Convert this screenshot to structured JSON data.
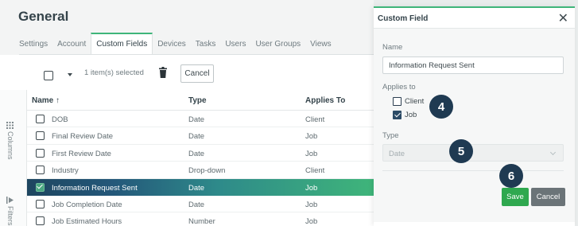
{
  "page": {
    "title": "General"
  },
  "tabs": [
    "Settings",
    "Account",
    "Custom Fields",
    "Devices",
    "Tasks",
    "Users",
    "User Groups",
    "Views"
  ],
  "active_tab": "Custom Fields",
  "toolbar": {
    "selected_text": "1 item(s) selected",
    "cancel_label": "Cancel",
    "trash_icon": "trash-icon"
  },
  "rail": {
    "columns_label": "Columns",
    "filters_label": "Filters"
  },
  "table": {
    "columns": {
      "name": "Name ↑",
      "type": "Type",
      "applies_to": "Applies To"
    },
    "rows": [
      {
        "name": "DOB",
        "type": "Date",
        "applies_to": "Client",
        "selected": false
      },
      {
        "name": "Final Review Date",
        "type": "Date",
        "applies_to": "Job",
        "selected": false
      },
      {
        "name": "First Review Date",
        "type": "Date",
        "applies_to": "Job",
        "selected": false
      },
      {
        "name": "Industry",
        "type": "Drop-down",
        "applies_to": "Client",
        "selected": false
      },
      {
        "name": "Information Request Sent",
        "type": "Date",
        "applies_to": "Job",
        "selected": true
      },
      {
        "name": "Job Completion Date",
        "type": "Date",
        "applies_to": "Job",
        "selected": false
      },
      {
        "name": "Job Estimated Hours",
        "type": "Number",
        "applies_to": "Job",
        "selected": false
      }
    ]
  },
  "panel": {
    "title": "Custom Field",
    "close_glyph": "✕",
    "name_label": "Name",
    "name_value": "Information Request Sent",
    "applies_label": "Applies to",
    "options": [
      {
        "label": "Client",
        "checked": false
      },
      {
        "label": "Job",
        "checked": true
      }
    ],
    "type_label": "Type",
    "type_value": "Date",
    "save_label": "Save",
    "cancel_label": "Cancel"
  },
  "steps": [
    "4",
    "5",
    "6"
  ],
  "colors": {
    "accent": "#3fb57a",
    "save": "#2fa84f",
    "callout": "#1f3a52",
    "selected_row_start": "#1e4660"
  }
}
